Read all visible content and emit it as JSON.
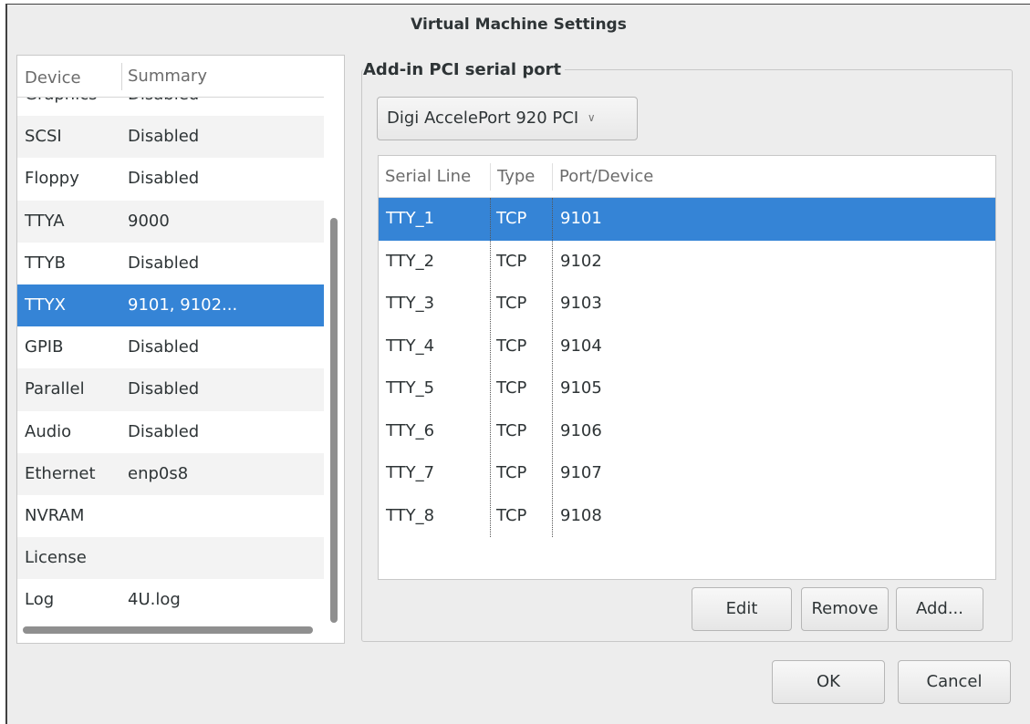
{
  "window": {
    "title": "Virtual Machine Settings"
  },
  "device_list": {
    "headers": [
      "Device",
      "Summary"
    ],
    "rows": [
      {
        "device": "Graphics",
        "summary": "Disabled"
      },
      {
        "device": "SCSI",
        "summary": "Disabled"
      },
      {
        "device": "Floppy",
        "summary": "Disabled"
      },
      {
        "device": "TTYA",
        "summary": "9000"
      },
      {
        "device": "TTYB",
        "summary": "Disabled"
      },
      {
        "device": "TTYX",
        "summary": "9101, 9102..."
      },
      {
        "device": "GPIB",
        "summary": "Disabled"
      },
      {
        "device": "Parallel",
        "summary": "Disabled"
      },
      {
        "device": "Audio",
        "summary": "Disabled"
      },
      {
        "device": "Ethernet",
        "summary": "enp0s8"
      },
      {
        "device": "NVRAM",
        "summary": ""
      },
      {
        "device": "License",
        "summary": ""
      },
      {
        "device": "Log",
        "summary": "4U.log"
      }
    ],
    "selected_device": "TTYX"
  },
  "serial_panel": {
    "frame_label": "Add-in PCI serial port",
    "card_select": {
      "value": "Digi AccelePort 920 PCI",
      "icon": "chevron-down-icon"
    },
    "table": {
      "headers": [
        "Serial Line",
        "Type",
        "Port/Device"
      ],
      "rows": [
        {
          "line": "TTY_1",
          "type": "TCP",
          "port": "9101"
        },
        {
          "line": "TTY_2",
          "type": "TCP",
          "port": "9102"
        },
        {
          "line": "TTY_3",
          "type": "TCP",
          "port": "9103"
        },
        {
          "line": "TTY_4",
          "type": "TCP",
          "port": "9104"
        },
        {
          "line": "TTY_5",
          "type": "TCP",
          "port": "9105"
        },
        {
          "line": "TTY_6",
          "type": "TCP",
          "port": "9106"
        },
        {
          "line": "TTY_7",
          "type": "TCP",
          "port": "9107"
        },
        {
          "line": "TTY_8",
          "type": "TCP",
          "port": "9108"
        }
      ],
      "selected_line": "TTY_1"
    },
    "buttons": {
      "edit": "Edit",
      "remove": "Remove",
      "add": "Add..."
    }
  },
  "dialog_buttons": {
    "ok": "OK",
    "cancel": "Cancel"
  },
  "colors": {
    "selection": "#3584d6",
    "background": "#ededed"
  }
}
